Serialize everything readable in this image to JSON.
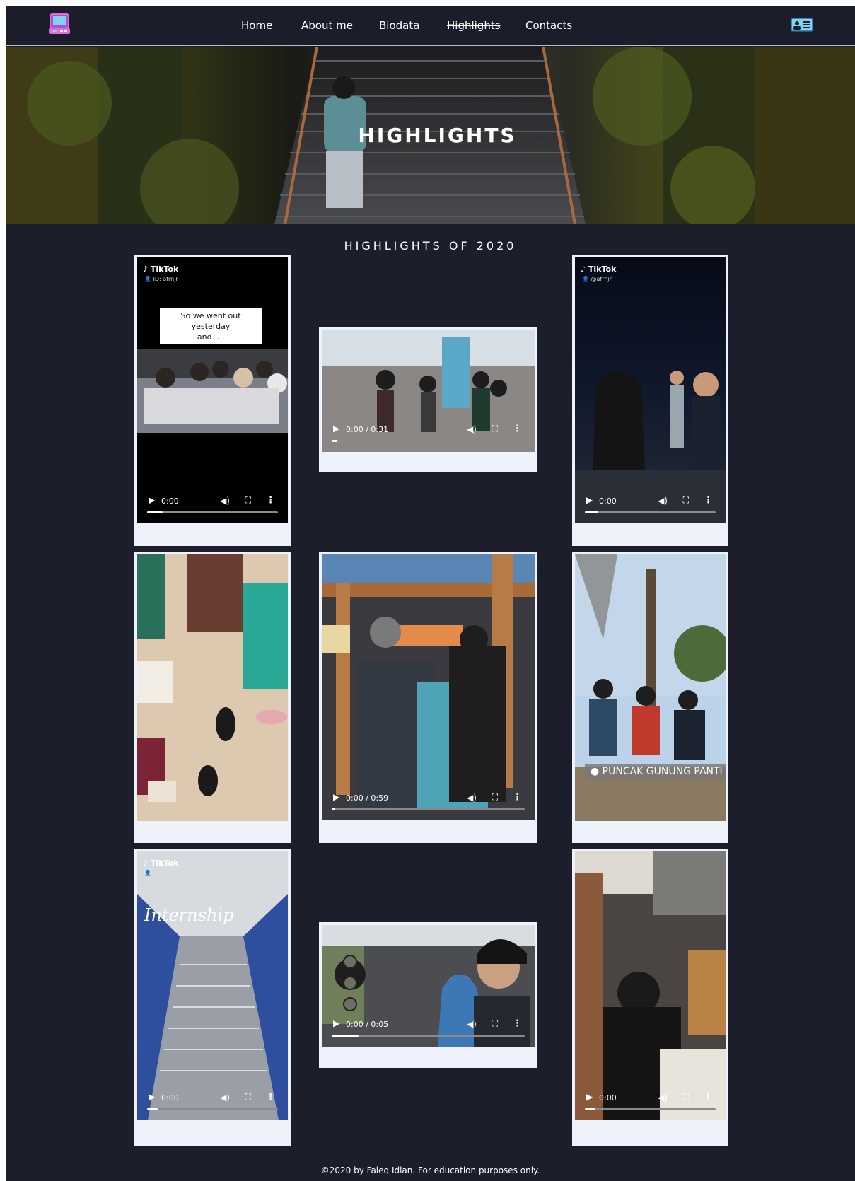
{
  "nav": {
    "links": [
      {
        "label": "Home"
      },
      {
        "label": "About me"
      },
      {
        "label": "Biodata"
      },
      {
        "label": "Highlights",
        "active": true
      },
      {
        "label": "Contacts"
      }
    ]
  },
  "hero": {
    "title": "HIGHLIGHTS"
  },
  "section": {
    "title": "HIGHLIGHTS OF 2020"
  },
  "videos": [
    {
      "badge": "TikTok",
      "user": "ID: afrnjr",
      "caption_line1": "So we went out yesterday",
      "caption_line2": "and. . .",
      "time": "0:00"
    },
    {
      "time": "0:00 / 0:31"
    },
    {
      "badge": "TikTok",
      "user": "@afrnjr",
      "time": "0:00"
    },
    {},
    {
      "time": "0:00 / 0:59"
    },
    {
      "location": "PUNCAK GUNUNG PANTI"
    },
    {
      "badge": "TikTok",
      "user": "@faieqidlan",
      "overlay": "Internship",
      "time": "0:00"
    },
    {
      "time": "0:00 / 0:05"
    },
    {
      "time": "0:00"
    }
  ],
  "footer": {
    "text": "©2020 by Faieq Idlan. For education purposes only."
  },
  "colors": {
    "background": "#1d1e2c",
    "card": "#eef3fb",
    "accent": "#e26bd9"
  }
}
